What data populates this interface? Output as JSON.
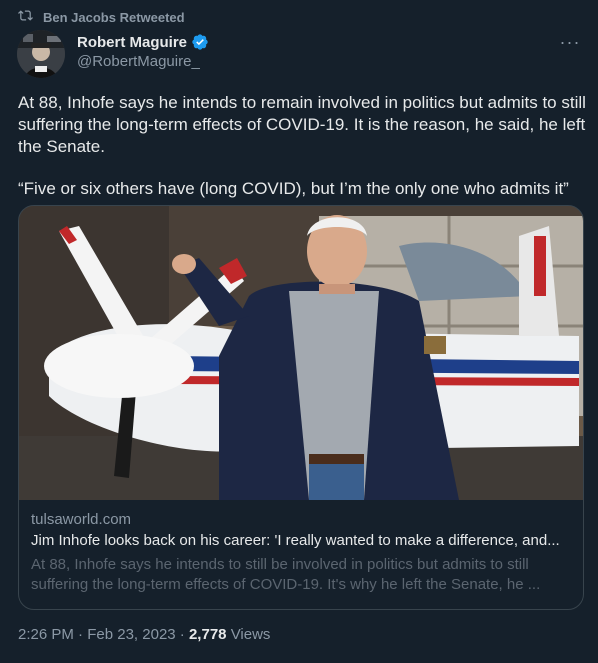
{
  "retweet": {
    "icon": "retweet-icon",
    "label": "Ben Jacobs Retweeted"
  },
  "author": {
    "name": "Robert Maguire",
    "handle": "@RobertMaguire_",
    "verified_icon": "verified-badge-icon",
    "verified_color": "#1d9bf0"
  },
  "more_icon": "more-horizontal-icon",
  "more_label": "···",
  "tweet": {
    "paragraph1": "At 88, Inhofe says he intends to remain involved in politics but admits to still suffering the long-term effects of COVID-19. It is the reason, he said, he left the Senate.",
    "paragraph2": "“Five or six others have (long COVID), but I’m the only one who admits it”"
  },
  "card": {
    "image_icon": "photo-man-with-airplane-propeller",
    "domain": "tulsaworld.com",
    "title": "Jim Inhofe looks back on his career: 'I really wanted to make a difference, and...",
    "description": "At 88, Inhofe says he intends to still be involved in politics but admits to still suffering the long-term effects of COVID-19. It's why he left the Senate, he ..."
  },
  "meta": {
    "time": "2:26 PM",
    "sep1": "·",
    "date": "Feb 23, 2023",
    "sep2": "·",
    "views_count": "2,778",
    "views_label": "Views"
  },
  "colors": {
    "background": "#15202b",
    "text": "#e7e9ea",
    "muted": "#8b98a5",
    "border": "#38444d"
  }
}
